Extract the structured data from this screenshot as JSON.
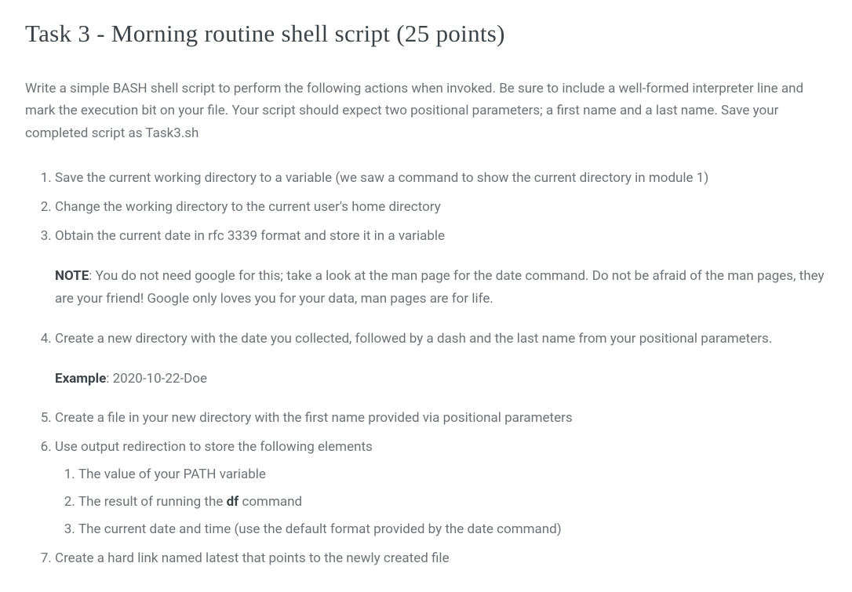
{
  "title": "Task 3 - Morning routine shell script (25 points)",
  "intro": "Write a simple BASH shell script to perform the following actions when invoked. Be sure to include a well-formed interpreter line and mark the execution bit on your file. Your script should expect two positional parameters; a first name and a last name. Save your completed script as Task3.sh",
  "items": {
    "i1": "Save the current working directory to a variable (we saw a command to show the current directory in module 1)",
    "i2": "Change the working directory to the current user's home directory",
    "i3": "Obtain the current date in rfc 3339 format and store it in a variable",
    "note_label": "NOTE",
    "note_text": ": You do not need google for this; take a look at the man page for the date command. Do not be afraid of the man pages, they are your friend! Google only loves you for your data, man pages are for life.",
    "i4": "Create a new directory with the date you collected, followed by a dash and the last name from your positional parameters.",
    "example_label": "Example",
    "example_text": ": 2020-10-22-Doe",
    "i5": "Create a file in your new directory with the first name provided via positional parameters",
    "i6": "Use output redirection to store the following elements",
    "i6_1": "The value of your PATH variable",
    "i6_2a": "The result of running the ",
    "i6_2b": "df",
    "i6_2c": " command",
    "i6_3": "The current date and time (use the default format provided by the date command)",
    "i7": "Create a hard link named latest that points to the newly created file"
  }
}
